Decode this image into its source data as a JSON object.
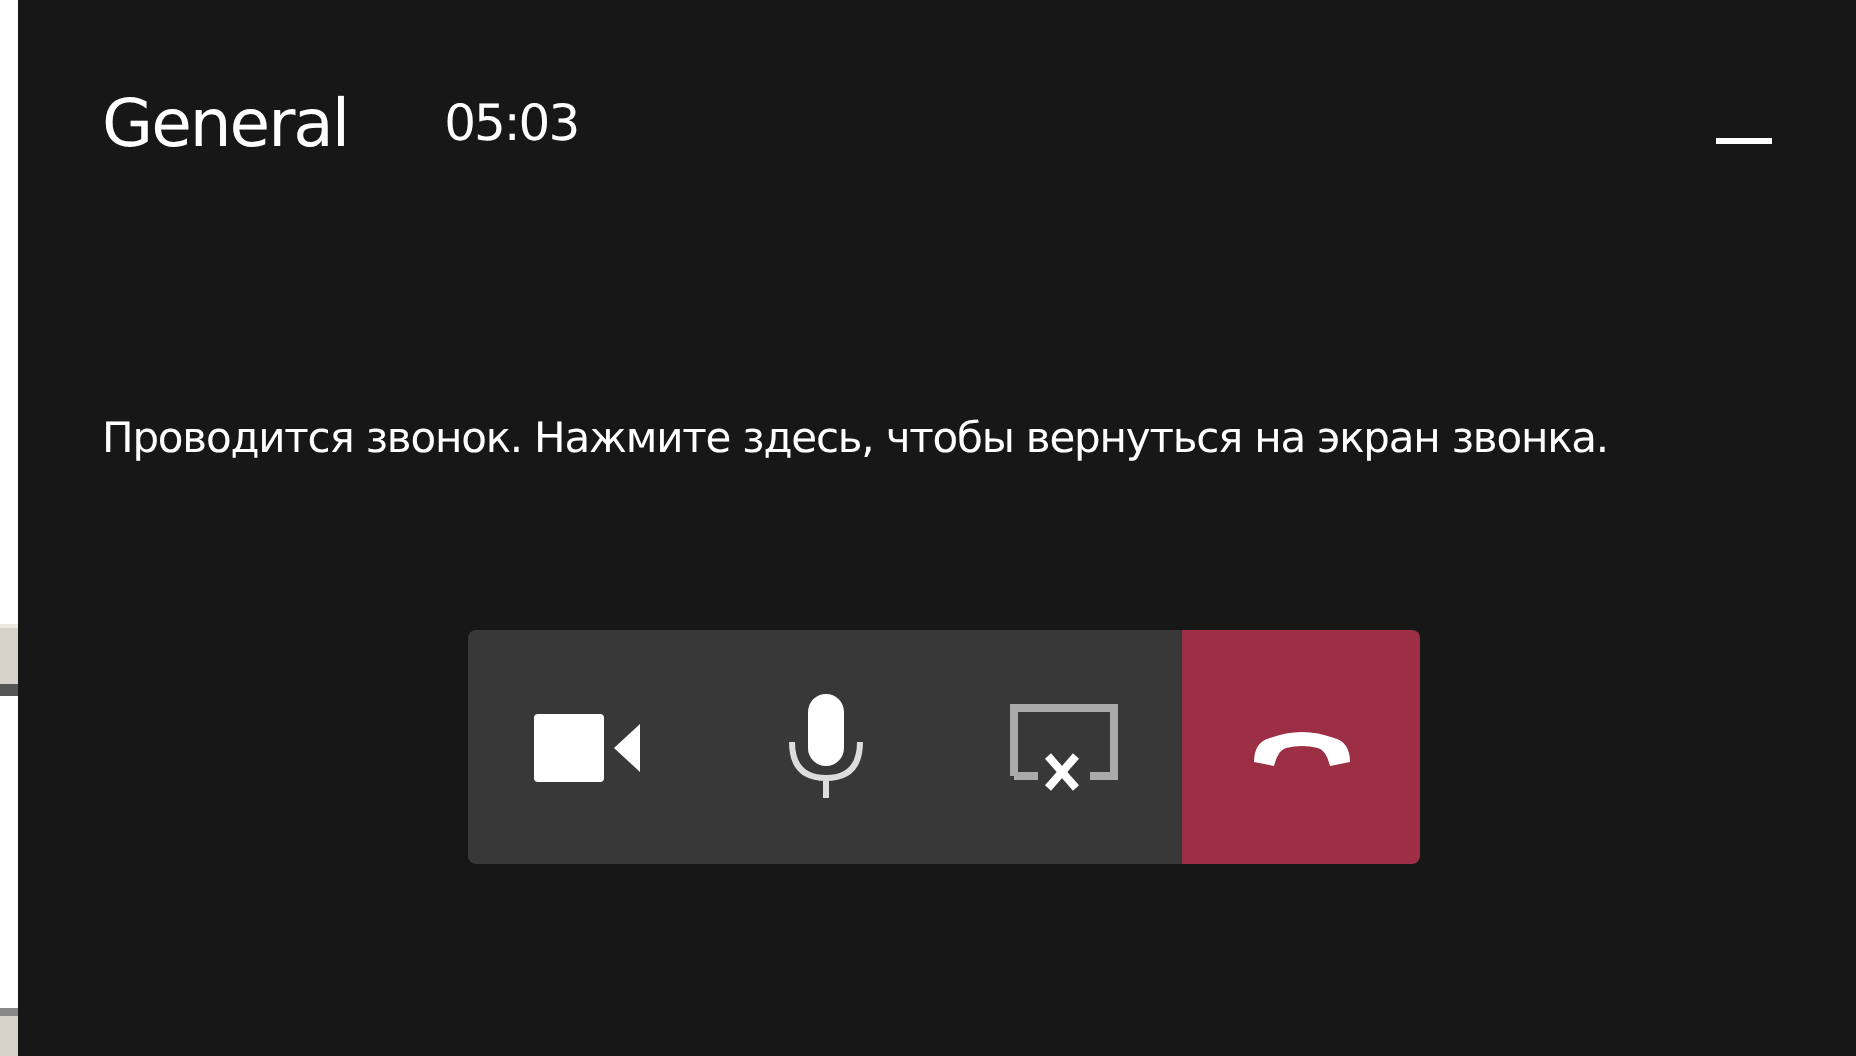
{
  "header": {
    "title": "General",
    "timer": "05:03"
  },
  "message": "Проводится звонок. Нажмите здесь, чтобы вернуться на экран звонка.",
  "controls": [
    {
      "kind": "camera"
    },
    {
      "kind": "microphone"
    },
    {
      "kind": "share"
    },
    {
      "kind": "hangup"
    }
  ]
}
